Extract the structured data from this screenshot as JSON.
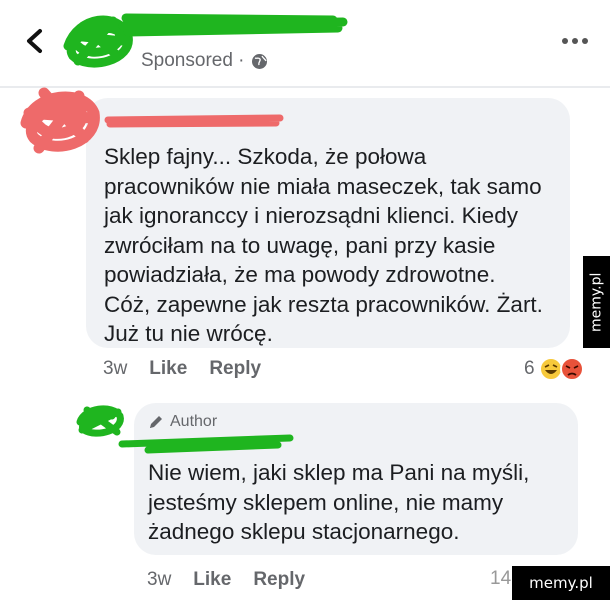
{
  "header": {
    "sponsored_label": "Sponsored · "
  },
  "comment": {
    "text": "Sklep fajny... Szkoda, że połowa pracowników nie miała maseczek, tak samo jak ignoranccy i nierozsądni klienci. Kiedy zwróciłam na to uwagę, pani przy kasie powiadziała, że ma powody zdrowotne. Cóż, zapewne jak reszta pracowników. Żart. Już tu nie wrócę.",
    "time": "3w",
    "like_label": "Like",
    "reply_label": "Reply",
    "reaction_count": "6"
  },
  "reply": {
    "author_badge": "Author",
    "text": "Nie wiem, jaki sklep ma Pani na myśli, jesteśmy sklepem online, nie mamy żadnego sklepu stacjonarnego.",
    "time": "3w",
    "like_label": "Like",
    "reply_label": "Reply",
    "reaction_count": "14"
  },
  "watermarks": {
    "side": "memy.pl",
    "bottom": "memy.pl"
  },
  "colors": {
    "bubble": "#f0f2f5",
    "meta_text": "#65676b",
    "scribble_green": "#1fb51f",
    "scribble_red": "#ee6a6a"
  },
  "icons": [
    "back-arrow-icon",
    "globe-icon",
    "more-icon",
    "pencil-icon",
    "laugh-emoji-icon",
    "angry-emoji-icon"
  ]
}
